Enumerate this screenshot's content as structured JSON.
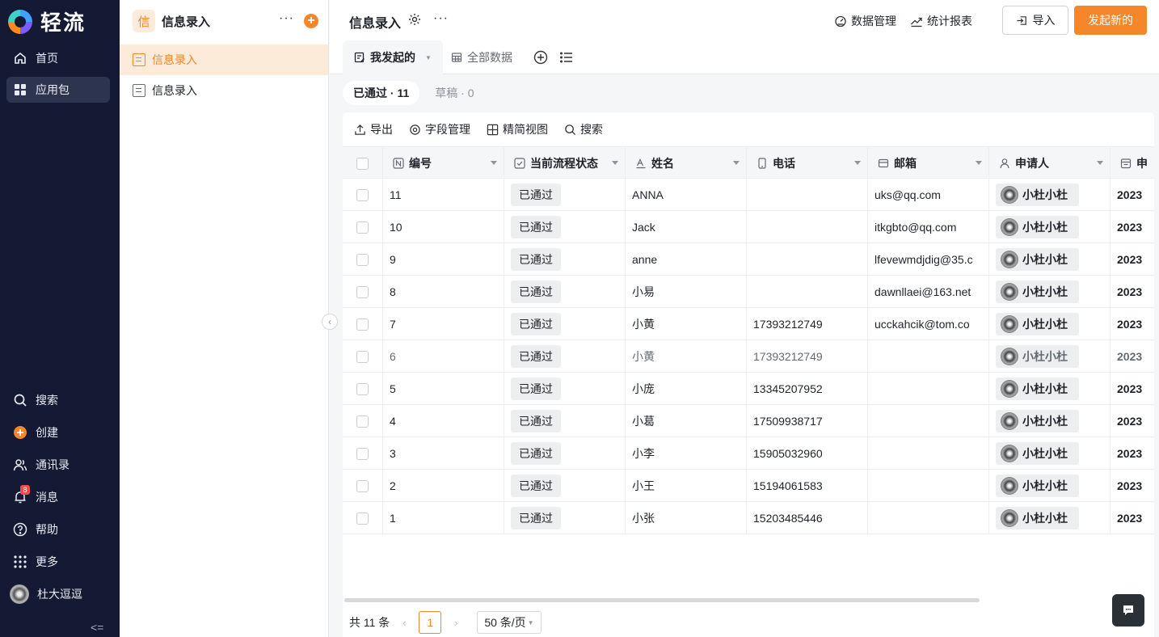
{
  "brand": {
    "name": "轻流"
  },
  "nav": {
    "top_items": [
      {
        "label": "首页",
        "icon": "home-icon"
      },
      {
        "label": "应用包",
        "icon": "apps-icon",
        "active": true
      }
    ],
    "bottom_items": [
      {
        "label": "搜索",
        "icon": "search-icon"
      },
      {
        "label": "创建",
        "icon": "plus-circle-icon"
      },
      {
        "label": "通讯录",
        "icon": "contacts-icon"
      },
      {
        "label": "消息",
        "icon": "bell-icon",
        "badge": "8"
      },
      {
        "label": "帮助",
        "icon": "help-icon"
      },
      {
        "label": "更多",
        "icon": "grid-icon"
      }
    ],
    "user_name": "杜大逗逗",
    "collapse_label": "<="
  },
  "sidebar": {
    "app_icon_char": "信",
    "title": "信息录入",
    "more": "···",
    "add": "+",
    "items": [
      {
        "label": "信息录入",
        "active": true
      },
      {
        "label": "信息录入",
        "active": false
      }
    ]
  },
  "header": {
    "title": "信息录入",
    "more": "···",
    "links": {
      "data_manage": "数据管理",
      "reports": "统计报表"
    },
    "import_label": "导入",
    "new_label": "发起新的"
  },
  "view_tabs": [
    {
      "label": "我发起的",
      "active": true
    },
    {
      "label": "全部数据",
      "active": false
    }
  ],
  "status_tabs": [
    {
      "label": "已通过 · 11",
      "active": true
    },
    {
      "label": "草稿 · 0",
      "active": false
    }
  ],
  "toolbar": {
    "export": "导出",
    "fields": "字段管理",
    "compact": "精简视图",
    "search": "搜索"
  },
  "table": {
    "columns": [
      "编号",
      "当前流程状态",
      "姓名",
      "电话",
      "邮箱",
      "申请人",
      "申"
    ],
    "rows": [
      {
        "id": "11",
        "status": "已通过",
        "name": "ANNA",
        "phone": "",
        "email": "uks@qq.com",
        "applicant": "小杜小杜",
        "date": "2023"
      },
      {
        "id": "10",
        "status": "已通过",
        "name": "Jack",
        "phone": "",
        "email": "itkgbto@qq.com",
        "applicant": "小杜小杜",
        "date": "2023"
      },
      {
        "id": "9",
        "status": "已通过",
        "name": "anne",
        "phone": "",
        "email": "lfevewmdjdig@35.c",
        "applicant": "小杜小杜",
        "date": "2023"
      },
      {
        "id": "8",
        "status": "已通过",
        "name": "小易",
        "phone": "",
        "email": "dawnllaei@163.net",
        "applicant": "小杜小杜",
        "date": "2023"
      },
      {
        "id": "7",
        "status": "已通过",
        "name": "小黄",
        "phone": "17393212749",
        "email": "ucckahcik@tom.co",
        "applicant": "小杜小杜",
        "date": "2023"
      },
      {
        "id": "6",
        "status": "已通过",
        "name": "小黄",
        "phone": "17393212749",
        "email": "",
        "applicant": "小杜小杜",
        "date": "2023",
        "muted": true
      },
      {
        "id": "5",
        "status": "已通过",
        "name": "小庞",
        "phone": "13345207952",
        "email": "",
        "applicant": "小杜小杜",
        "date": "2023"
      },
      {
        "id": "4",
        "status": "已通过",
        "name": "小葛",
        "phone": "17509938717",
        "email": "",
        "applicant": "小杜小杜",
        "date": "2023"
      },
      {
        "id": "3",
        "status": "已通过",
        "name": "小李",
        "phone": "15905032960",
        "email": "",
        "applicant": "小杜小杜",
        "date": "2023"
      },
      {
        "id": "2",
        "status": "已通过",
        "name": "小王",
        "phone": "15194061583",
        "email": "",
        "applicant": "小杜小杜",
        "date": "2023"
      },
      {
        "id": "1",
        "status": "已通过",
        "name": "小张",
        "phone": "15203485446",
        "email": "",
        "applicant": "小杜小杜",
        "date": "2023"
      }
    ]
  },
  "pager": {
    "total": "共 11 条",
    "current": "1",
    "page_size": "50 条/页"
  },
  "colors": {
    "accent": "#f5862a",
    "nav_bg": "#141a33",
    "badge": "#f54a45"
  }
}
